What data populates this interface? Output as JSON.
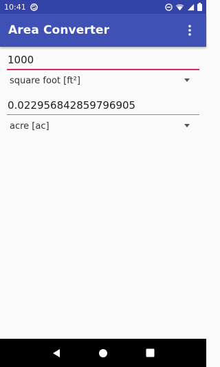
{
  "status_bar": {
    "time": "10:41",
    "icons": [
      "sync-circle-icon",
      "do-not-disturb-icon",
      "wifi-icon",
      "signal-icon",
      "battery-icon"
    ]
  },
  "app_bar": {
    "title": "Area Converter",
    "overflow_icon": "more-vert-icon"
  },
  "converter": {
    "input_value": "1000",
    "input_unit": "square foot [ft²]",
    "output_value": "0.022956842859796905",
    "output_unit": "acre [ac]"
  },
  "navigation": {
    "icons": [
      "back-icon",
      "home-icon",
      "recents-icon"
    ]
  },
  "colors": {
    "status_bar": "#3343a8",
    "app_bar": "#3f51b5",
    "accent": "#e91e63",
    "background": "#fafafa",
    "nav_bar": "#000000"
  }
}
